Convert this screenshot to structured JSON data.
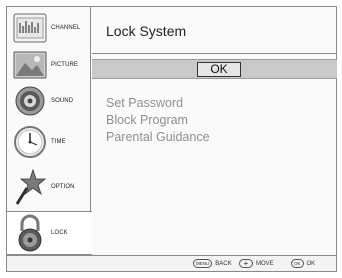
{
  "sidebar": {
    "items": [
      {
        "label": "CHANNEL",
        "icon": "channel-icon"
      },
      {
        "label": "PICTURE",
        "icon": "picture-icon"
      },
      {
        "label": "SOUND",
        "icon": "speaker-icon"
      },
      {
        "label": "TIME",
        "icon": "clock-icon"
      },
      {
        "label": "OPTION",
        "icon": "star-wand-icon"
      },
      {
        "label": "LOCK",
        "icon": "padlock-icon"
      }
    ],
    "active": "LOCK"
  },
  "main": {
    "title": "Lock System",
    "ok_label": "OK",
    "menu": [
      "Set Password",
      "Block Program",
      "Parental Guidance"
    ]
  },
  "footer": {
    "menu_key": "MENU",
    "back_label": "BACK",
    "move_label": "MOVE",
    "ok_key": "OK",
    "ok_label": "OK"
  }
}
